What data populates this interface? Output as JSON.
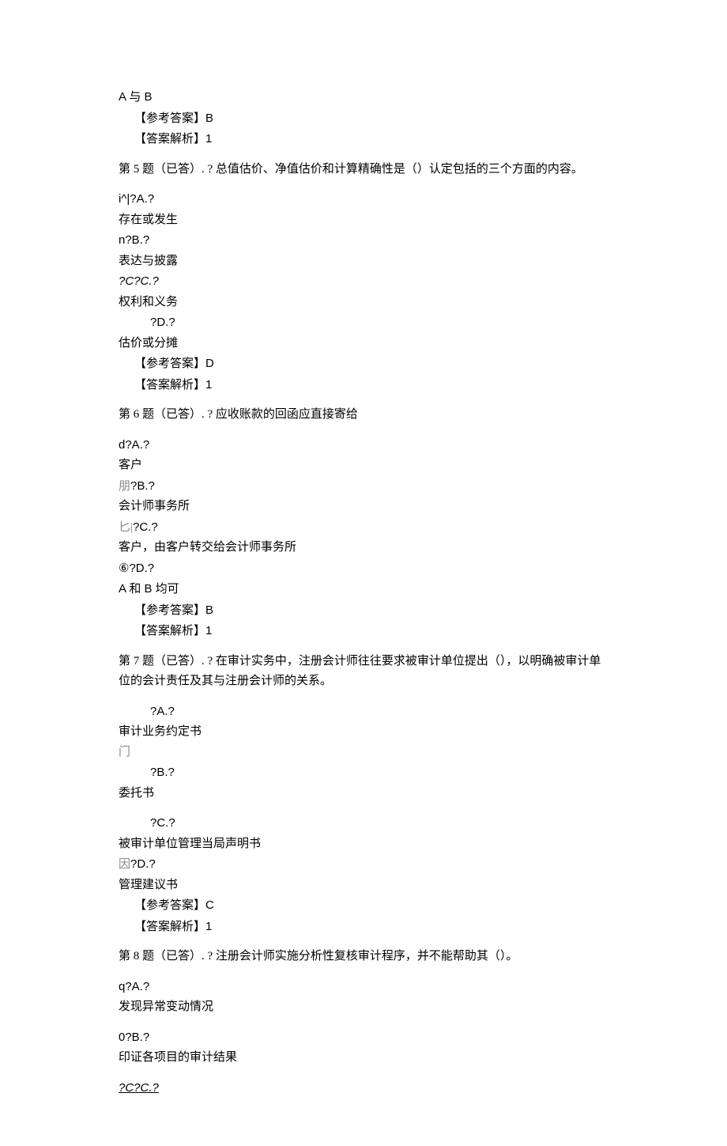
{
  "q4_trailing": {
    "last_option_text": "A 与 B",
    "answer_label": "【参考答案】",
    "answer_value": "B",
    "analysis_label": "【答案解析】",
    "analysis_value": "1"
  },
  "q5": {
    "header": "第 5 题（已答）. ? 总值估价、净值估价和计算精确性是（）认定包括的三个方面的内容。",
    "optA_prefix": "i^|?A.?",
    "optA_text": "存在或发生",
    "optB_prefix": "n?B.?",
    "optB_text": "表达与披露",
    "optC_prefix": "?C?C.?",
    "optC_text": "权利和义务",
    "optD_prefix": "?D.?",
    "optD_text": "估价或分摊",
    "answer_label": "【参考答案】",
    "answer_value": "D",
    "analysis_label": "【答案解析】",
    "analysis_value": "1"
  },
  "q6": {
    "header": "第 6 题（已答）. ? 应收账款的回函应直接寄给",
    "optA_prefix": "d?A.?",
    "optA_text": "客户",
    "optB_prefix_cn": "朋",
    "optB_prefix_west": "?B.?",
    "optB_text": "会计师事务所",
    "optC_prefix_cn": "匕|",
    "optC_prefix_west": "?C.?",
    "optC_text": "客户，由客户转交给会计师事务所",
    "optD_prefix": "⑥?D.?",
    "optD_text": "A 和 B 均可",
    "answer_label": "【参考答案】",
    "answer_value": "B",
    "analysis_label": "【答案解析】",
    "analysis_value": "1"
  },
  "q7": {
    "header": "第 7 题（已答）. ? 在审计实务中，注册会计师往往要求被审计单位提出（），以明确被审计单位的会计责任及其与注册会计师的关系。",
    "optA_prefix": "?A.?",
    "optA_text": "审计业务约定书",
    "optB_prefix_cn": "门",
    "optB_prefix_west": "?B.?",
    "optB_text": "委托书",
    "optC_prefix": "?C.?",
    "optC_text": "被审计单位管理当局声明书",
    "optD_prefix_cn": "因",
    "optD_prefix_west": "?D.?",
    "optD_text": "管理建议书",
    "answer_label": "【参考答案】",
    "answer_value": "C",
    "analysis_label": "【答案解析】",
    "analysis_value": "1"
  },
  "q8": {
    "header": "第 8 题（已答）. ? 注册会计师实施分析性复核审计程序，并不能帮助其（）。",
    "optA_prefix": "q?A.?",
    "optA_text": "发现异常变动情况",
    "optB_prefix": "0?B.?",
    "optB_text": "印证各项目的审计结果",
    "optC_prefix": "?C?C.?"
  }
}
